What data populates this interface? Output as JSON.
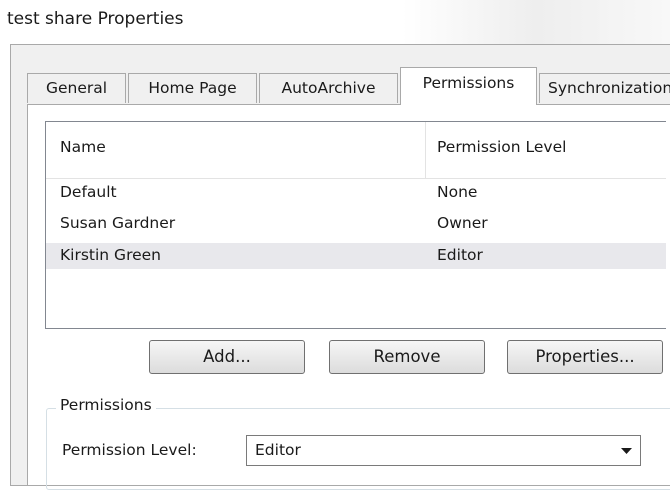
{
  "window": {
    "title": "test share Properties"
  },
  "tabs": [
    {
      "label": "General",
      "active": false
    },
    {
      "label": "Home Page",
      "active": false
    },
    {
      "label": "AutoArchive",
      "active": false
    },
    {
      "label": "Permissions",
      "active": true
    },
    {
      "label": "Synchronization",
      "active": false
    }
  ],
  "permissions_list": {
    "columns": [
      "Name",
      "Permission Level"
    ],
    "rows": [
      {
        "name": "Default",
        "level": "None",
        "selected": false
      },
      {
        "name": "Susan Gardner",
        "level": "Owner",
        "selected": false
      },
      {
        "name": "Kirstin Green",
        "level": "Editor",
        "selected": true
      }
    ]
  },
  "buttons": {
    "add": "Add...",
    "remove": "Remove",
    "properties": "Properties..."
  },
  "permissions_group": {
    "legend": "Permissions",
    "level_label": "Permission Level:",
    "level_value": "Editor"
  },
  "colors": {
    "selected_row": "#e8e8ec",
    "dialog_bg": "#f0f0f0",
    "border": "#a9a9a9"
  }
}
